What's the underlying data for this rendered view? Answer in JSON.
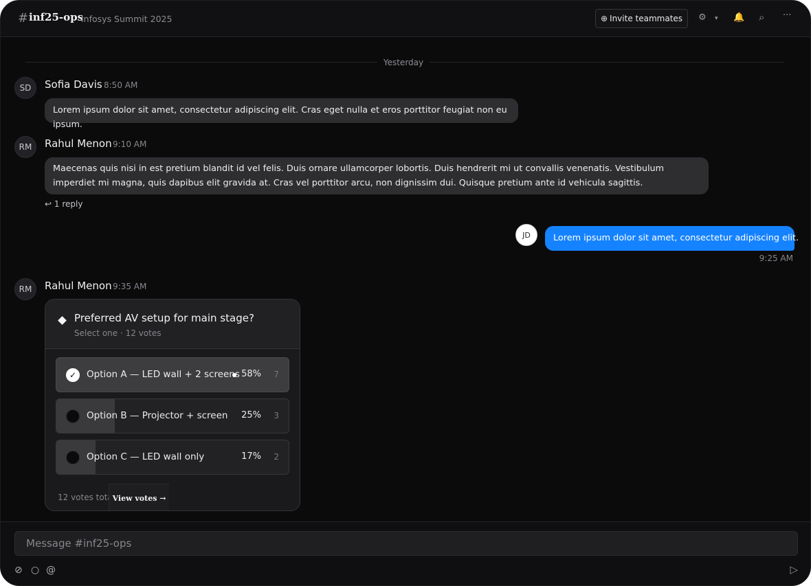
{
  "header": {
    "hash": "#",
    "channel": "inf25-ops",
    "subtitle": "Infosys Summit 2025",
    "invite_label": "Invite teammates",
    "invite_icon": "⊕",
    "icons": {
      "settings": "⚙",
      "caret": "▾",
      "bell": "🔔",
      "search": "⌕",
      "more": "···"
    }
  },
  "divider_label": "Yesterday",
  "messages": [
    {
      "initials": "SD",
      "name": "Sofia Davis",
      "time": "8:50 AM",
      "text": "Lorem ipsum dolor sit amet, consectetur adipiscing elit. Cras eget nulla et eros porttitor feugiat non eu ipsum."
    },
    {
      "initials": "RM",
      "name": "Rahul Menon",
      "time": "9:10 AM",
      "text": "Maecenas quis nisi in est pretium blandit id vel felis. Duis ornare ullamcorper lobortis. Duis hendrerit mi ut convallis venenatis. Vestibulum imperdiet mi magna, quis dapibus elit gravida at. Cras vel porttitor arcu, non dignissim dui. Quisque pretium ante id vehicula sagittis.",
      "reply_label": "↩ 1 reply"
    },
    {
      "initials": "JD",
      "time": "9:25 AM",
      "text": "Lorem ipsum dolor sit amet, consectetur adipiscing elit."
    },
    {
      "initials": "RM",
      "name": "Rahul Menon",
      "time": "9:35 AM"
    }
  ],
  "poll": {
    "question": "Preferred AV setup for main stage?",
    "meta": "Select one · 12 votes",
    "options": [
      {
        "label": "Option A — LED wall + 2 screens",
        "pct_label": "58%",
        "share": 0.58,
        "count": "7",
        "selected": true,
        "check": "✓"
      },
      {
        "label": "Option B — Projector + screen",
        "pct_label": "25%",
        "share": 0.25,
        "count": "3",
        "selected": false
      },
      {
        "label": "Option C — LED wall only",
        "pct_label": "17%",
        "share": 0.17,
        "count": "2",
        "selected": false
      }
    ],
    "total_label": "12 votes total",
    "view_votes_label": "View votes →"
  },
  "composer": {
    "placeholder": "Message #inf25-ops",
    "icons": {
      "attach": "⊘",
      "emoji": "○",
      "mention": "@",
      "send": "▷"
    }
  }
}
